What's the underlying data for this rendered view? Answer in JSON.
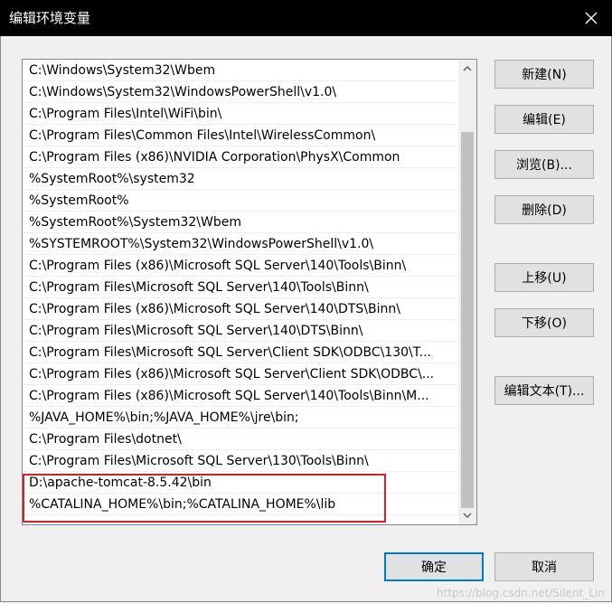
{
  "window": {
    "title": "编辑环境变量",
    "close_icon": "close-icon"
  },
  "paths": [
    "C:\\Windows\\System32\\Wbem",
    "C:\\Windows\\System32\\WindowsPowerShell\\v1.0\\",
    "C:\\Program Files\\Intel\\WiFi\\bin\\",
    "C:\\Program Files\\Common Files\\Intel\\WirelessCommon\\",
    "C:\\Program Files (x86)\\NVIDIA Corporation\\PhysX\\Common",
    "%SystemRoot%\\system32",
    "%SystemRoot%",
    "%SystemRoot%\\System32\\Wbem",
    "%SYSTEMROOT%\\System32\\WindowsPowerShell\\v1.0\\",
    "C:\\Program Files (x86)\\Microsoft SQL Server\\140\\Tools\\Binn\\",
    "C:\\Program Files\\Microsoft SQL Server\\140\\Tools\\Binn\\",
    "C:\\Program Files (x86)\\Microsoft SQL Server\\140\\DTS\\Binn\\",
    "C:\\Program Files\\Microsoft SQL Server\\140\\DTS\\Binn\\",
    "C:\\Program Files\\Microsoft SQL Server\\Client SDK\\ODBC\\130\\T...",
    "C:\\Program Files (x86)\\Microsoft SQL Server\\Client SDK\\ODBC\\...",
    "C:\\Program Files (x86)\\Microsoft SQL Server\\140\\Tools\\Binn\\M...",
    "%JAVA_HOME%\\bin;%JAVA_HOME%\\jre\\bin;",
    "C:\\Program Files\\dotnet\\",
    "C:\\Program Files\\Microsoft SQL Server\\130\\Tools\\Binn\\",
    "D:\\apache-tomcat-8.5.42\\bin",
    "%CATALINA_HOME%\\bin;%CATALINA_HOME%\\lib"
  ],
  "buttons": {
    "new": "新建(N)",
    "edit": "编辑(E)",
    "browse": "浏览(B)...",
    "delete": "删除(D)",
    "move_up": "上移(U)",
    "move_down": "下移(O)",
    "edit_text": "编辑文本(T)...",
    "ok": "确定",
    "cancel": "取消"
  },
  "watermark": "https://blog.csdn.net/Silent_Lin",
  "colors": {
    "highlight_border": "#d71f27",
    "primary_border": "#0078d7",
    "titlebar": "#000000"
  }
}
